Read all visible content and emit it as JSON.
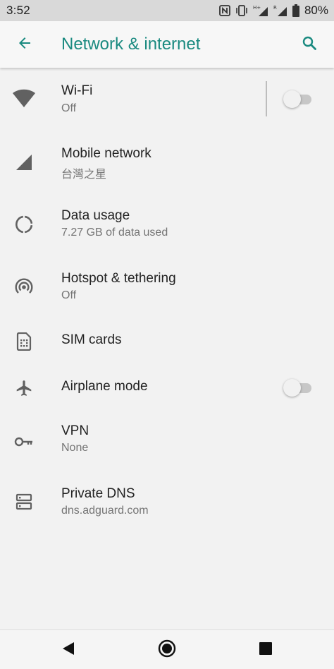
{
  "status_bar": {
    "time": "3:52",
    "battery": "80%",
    "icons": [
      "nfc-icon",
      "vibrate-icon",
      "signal-hplus-icon",
      "signal-roaming-icon",
      "battery-icon"
    ]
  },
  "app_bar": {
    "title": "Network & internet",
    "back_icon": "arrow-back-icon",
    "search_icon": "search-icon",
    "accent_color": "#1a8a80"
  },
  "settings": [
    {
      "id": "wifi",
      "icon": "wifi-icon",
      "title": "Wi‑Fi",
      "subtitle": "Off",
      "toggle": false
    },
    {
      "id": "mobile-network",
      "icon": "cell-signal-icon",
      "title": "Mobile network",
      "subtitle": "台灣之星"
    },
    {
      "id": "data-usage",
      "icon": "data-usage-icon",
      "title": "Data usage",
      "subtitle": "7.27 GB of data used"
    },
    {
      "id": "hotspot",
      "icon": "hotspot-icon",
      "title": "Hotspot & tethering",
      "subtitle": "Off"
    },
    {
      "id": "sim-cards",
      "icon": "sim-card-icon",
      "title": "SIM cards"
    },
    {
      "id": "airplane-mode",
      "icon": "airplane-icon",
      "title": "Airplane mode",
      "toggle": false
    },
    {
      "id": "vpn",
      "icon": "vpn-key-icon",
      "title": "VPN",
      "subtitle": "None"
    },
    {
      "id": "private-dns",
      "icon": "dns-icon",
      "title": "Private DNS",
      "subtitle": "dns.adguard.com"
    }
  ],
  "nav_bar": {
    "back": "nav-back-icon",
    "home": "nav-home-icon",
    "recents": "nav-recents-icon"
  }
}
